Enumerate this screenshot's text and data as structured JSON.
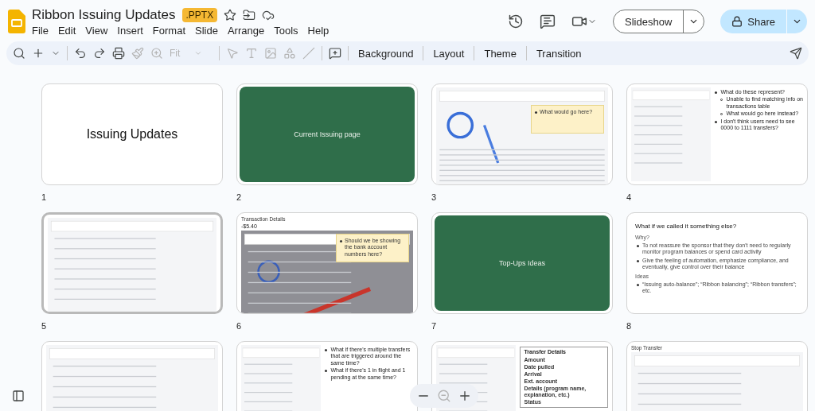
{
  "document": {
    "title": "Ribbon Issuing Updates",
    "badge": ".PPTX"
  },
  "menu": [
    "File",
    "Edit",
    "View",
    "Insert",
    "Format",
    "Slide",
    "Arrange",
    "Tools",
    "Help"
  ],
  "toolbar": {
    "zoom": "Fit",
    "buttons": [
      "Background",
      "Layout",
      "Theme",
      "Transition"
    ]
  },
  "actions": {
    "slideshow": "Slideshow",
    "share": "Share"
  },
  "slides": [
    {
      "number": "1",
      "selected": false,
      "kind": "title",
      "title": "Issuing Updates"
    },
    {
      "number": "2",
      "selected": false,
      "kind": "section",
      "title": "Current Issuing page"
    },
    {
      "number": "3",
      "selected": false,
      "kind": "mock",
      "sticky": "What would go here?"
    },
    {
      "number": "4",
      "selected": false,
      "kind": "mock",
      "bullets": [
        {
          "text": "What do these represent?",
          "children": [
            "Unable to find matching info on transactions table",
            "What would go here instead?"
          ]
        },
        {
          "text": "I don't think users need to see 0000 to 1111 transfers?"
        }
      ]
    },
    {
      "number": "5",
      "selected": true,
      "kind": "mock"
    },
    {
      "number": "6",
      "selected": false,
      "kind": "mock",
      "heading": "Transaction Details",
      "amount": "-$5.40",
      "sticky": "Should we be showing the bank account numbers here?"
    },
    {
      "number": "7",
      "selected": false,
      "kind": "section",
      "title": "Top-Ups Ideas"
    },
    {
      "number": "8",
      "selected": false,
      "kind": "text",
      "title": "What if we called it something else?",
      "sections": [
        {
          "label": "Why?",
          "bullets": [
            "To not reassure the sponsor that they don't need to regularly monitor program balances or spend card activity",
            "Give the feeling of automation, emphasize compliance, and eventually, give control over their balance"
          ]
        },
        {
          "label": "Ideas",
          "bullets": [
            "“Issuing auto-balance”; “Ribbon balancing”; “Ribbon transfers”; etc."
          ]
        }
      ]
    },
    {
      "kind": "mock",
      "selected": false
    },
    {
      "kind": "mock",
      "selected": false,
      "bullets": [
        {
          "text": "What if there's multiple transfers that are triggered around the same time?"
        },
        {
          "text": "What if there's 1 in flight and 1 pending at the same time?"
        }
      ]
    },
    {
      "kind": "mock",
      "selected": false,
      "panel": {
        "title": "Transfer Details",
        "items": [
          "Amount",
          "Date pulled",
          "Arrival",
          "Ext. account",
          "Details (program name, explanation, etc.)",
          "Status"
        ]
      }
    },
    {
      "kind": "mock",
      "selected": false,
      "heading": "Stop Transfer"
    }
  ]
}
